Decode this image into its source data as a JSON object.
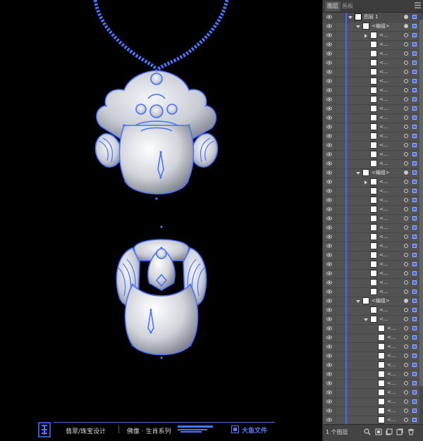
{
  "panel": {
    "tabs": [
      "图层",
      "画板"
    ],
    "layer_count": "1 个图层",
    "top_layer": "图层 1",
    "group_label": "<编组>",
    "path_label": "<..."
  },
  "footer": {
    "text_1": "翡翠/珠宝设计",
    "text_2": "佛像 · 生肖系列",
    "brand": "大鱼文件"
  },
  "colors": {
    "selection": "#3f69ff",
    "panel_bg": "#535353",
    "tab_bg": "#3c3c3c"
  }
}
